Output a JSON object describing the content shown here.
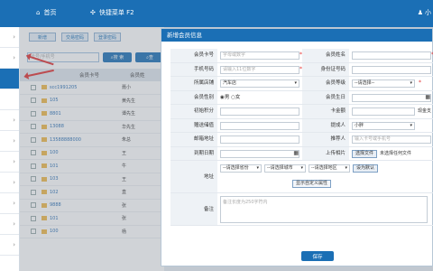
{
  "topbar": {
    "home_label": "首页",
    "menu_label": "快捷菜单 F2",
    "user_label": "小"
  },
  "sidebar": {
    "rows": [
      "›",
      "›",
      "",
      "",
      "›",
      "›",
      "›",
      "›",
      "›",
      "›",
      "›"
    ]
  },
  "bg_list": {
    "buttons": [
      "新增",
      "交易密码",
      "登录密码"
    ],
    "search_placeholder": "卡号/手机号",
    "search_label": "搜 索",
    "search2_label": "查",
    "columns": [
      "会员卡号",
      "会员姓"
    ],
    "rows": [
      {
        "card": "scc1991205",
        "name": "聂小"
      },
      {
        "card": "105",
        "name": "黄先生"
      },
      {
        "card": "8801",
        "name": "谭先生"
      },
      {
        "card": "13088",
        "name": "华先生"
      },
      {
        "card": "13588888000",
        "name": "朱总"
      },
      {
        "card": "100",
        "name": "王"
      },
      {
        "card": "101",
        "name": "牛"
      },
      {
        "card": "103",
        "name": "王"
      },
      {
        "card": "102",
        "name": "直"
      },
      {
        "card": "9888",
        "name": "张"
      },
      {
        "card": "101",
        "name": "张"
      },
      {
        "card": "100",
        "name": "杨"
      }
    ]
  },
  "modal": {
    "title": "新增会员信息",
    "card_no_label": "会员卡号",
    "card_no_placeholder": "字母或数字",
    "name_label": "会员姓名",
    "phone_label": "手机号码",
    "phone_placeholder": "请输入11位数字",
    "id_label": "身份证号码",
    "store_label": "所属店铺",
    "store_value": "汽车店",
    "level_label": "会员等级",
    "level_value": "--请选择--",
    "gender_label": "会员性别",
    "gender_male": "男",
    "gender_female": "女",
    "birthday_label": "会员生日",
    "points_label": "初始积分",
    "balance_label": "卡金额",
    "balance_suffix": "现金支",
    "gift_label": "赠送储值",
    "referrer_label": "提成人",
    "referrer_value": "小胖",
    "email_label": "邮箱地址",
    "recommender_label": "推荐人",
    "recommender_placeholder": "输入卡号或手机号",
    "expire_label": "到期日期",
    "photo_label": "上传相片",
    "photo_button": "选择文件",
    "photo_text": "未选择任何文件",
    "address_label": "地址",
    "province_value": "--请选择省份",
    "city_value": "--请选择城市",
    "district_value": "--请选择地区",
    "set_default": "设为默认",
    "custom_attr": "显示自定义属性",
    "note_label": "备注",
    "note_placeholder": "备注长度为250字符内",
    "save_label": "保存"
  }
}
